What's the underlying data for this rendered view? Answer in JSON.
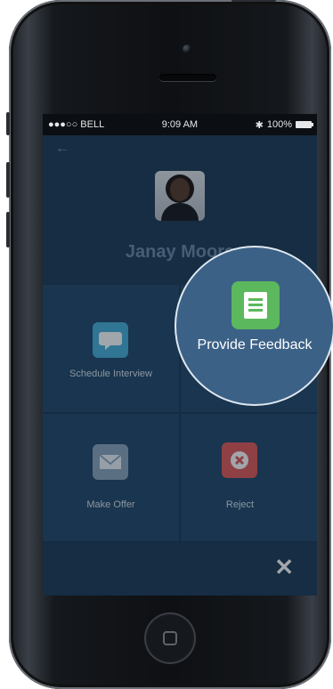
{
  "status_bar": {
    "carrier": "●●●○○ BELL",
    "time": "9:09 AM",
    "battery": "100%"
  },
  "header": {
    "name": "Janay Moore"
  },
  "actions": {
    "schedule_interview": "Schedule Interview",
    "make_offer": "Make Offer",
    "reject": "Reject",
    "provide_feedback": "Provide Feedback"
  },
  "colors": {
    "screen_bg": "#1e3a56",
    "tile_bg": "#25496b",
    "schedule_icon": "#49b0d8",
    "offer_icon": "#8fa7bf",
    "reject_icon": "#e25b5b",
    "feedback_icon": "#5cb85c"
  },
  "icons": {
    "back": "back-arrow-icon",
    "schedule": "chat-bubble-icon",
    "offer": "envelope-icon",
    "reject": "close-circle-icon",
    "feedback": "document-list-icon",
    "close": "close-icon"
  }
}
